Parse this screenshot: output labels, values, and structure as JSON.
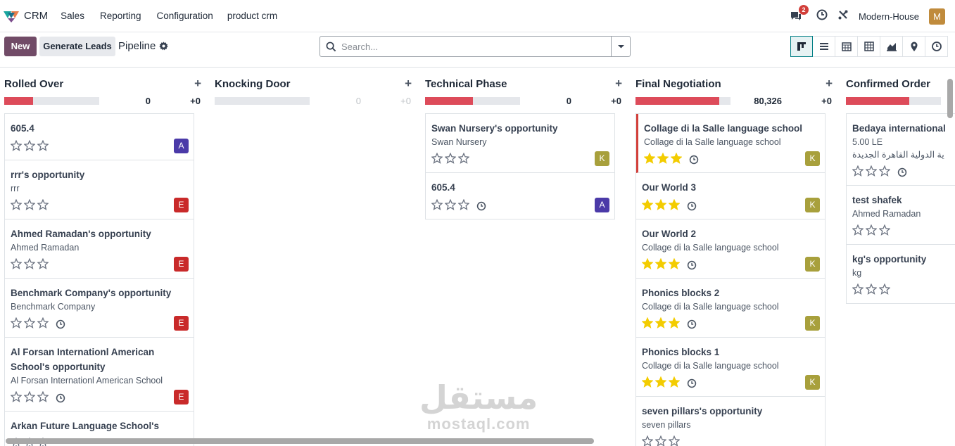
{
  "navbar": {
    "app_name": "CRM",
    "menu": [
      "Sales",
      "Reporting",
      "Configuration",
      "product crm"
    ],
    "message_count": "2",
    "company": "Modern-House",
    "user_initial": "M"
  },
  "control": {
    "new_label": "New",
    "generate_label": "Generate Leads",
    "breadcrumb": "Pipeline",
    "search_placeholder": "Search..."
  },
  "columns": [
    {
      "title": "Rolled Over",
      "total": "0",
      "plus": "+0",
      "progress": 0.3,
      "cards": [
        {
          "title": "605.4",
          "sub": "",
          "stars": 0,
          "clock": false,
          "user": "A",
          "user_color": "#4b3aa8"
        },
        {
          "title": "rrr's opportunity",
          "sub": "rrr",
          "stars": 0,
          "clock": false,
          "user": "E",
          "user_color": "#c92a2a"
        },
        {
          "title": "Ahmed Ramadan's opportunity",
          "sub": "Ahmed Ramadan",
          "stars": 0,
          "clock": false,
          "user": "E",
          "user_color": "#c92a2a"
        },
        {
          "title": "Benchmark Company's opportunity",
          "sub": "Benchmark Company",
          "stars": 0,
          "clock": true,
          "user": "E",
          "user_color": "#c92a2a"
        },
        {
          "title": "Al Forsan Internationl American School's opportunity",
          "sub": "Al Forsan Internationl American School",
          "stars": 0,
          "clock": true,
          "user": "E",
          "user_color": "#c92a2a"
        },
        {
          "title": "Arkan Future Language School's",
          "sub": "",
          "stars": 0,
          "clock": false,
          "user": "",
          "user_color": "#c92a2a"
        }
      ]
    },
    {
      "title": "Knocking Door",
      "total": "0",
      "plus": "+0",
      "progress": 0,
      "cards": []
    },
    {
      "title": "Technical Phase",
      "total": "0",
      "plus": "+0",
      "progress": 0.5,
      "cards": [
        {
          "title": "Swan Nursery's opportunity",
          "sub": "Swan Nursery",
          "stars": 0,
          "clock": false,
          "user": "K",
          "user_color": "#a8a03c"
        },
        {
          "title": "605.4",
          "sub": "",
          "stars": 0,
          "clock": true,
          "user": "A",
          "user_color": "#4b3aa8"
        }
      ]
    },
    {
      "title": "Final Negotiation",
      "total": "80,326",
      "plus": "+0",
      "progress": 0.88,
      "cards": [
        {
          "title": "Collage di la Salle language school",
          "sub": "Collage di la Salle language school",
          "stars": 3,
          "clock": true,
          "user": "K",
          "user_color": "#a8a03c",
          "accent": true
        },
        {
          "title": "Our World 3",
          "sub": "",
          "stars": 3,
          "clock": true,
          "user": "K",
          "user_color": "#a8a03c"
        },
        {
          "title": "Our World 2",
          "sub": "Collage di la Salle language school",
          "stars": 3,
          "clock": true,
          "user": "K",
          "user_color": "#a8a03c"
        },
        {
          "title": "Phonics blocks 2",
          "sub": "Collage di la Salle language school",
          "stars": 3,
          "clock": true,
          "user": "K",
          "user_color": "#a8a03c"
        },
        {
          "title": "Phonics blocks 1",
          "sub": "Collage di la Salle language school",
          "stars": 3,
          "clock": true,
          "user": "K",
          "user_color": "#a8a03c"
        },
        {
          "title": "seven pillars's opportunity",
          "sub": "seven pillars",
          "stars": 0,
          "clock": false,
          "user": "",
          "user_color": "#4b3aa8"
        }
      ]
    },
    {
      "title": "Confirmed Order",
      "total": "",
      "plus": "",
      "progress": 0.67,
      "cards": [
        {
          "title": "Bedaya international",
          "sub": "5.00 LE",
          "sub2": "ية الدولية القاهرة الجديدة",
          "stars": 0,
          "clock": true,
          "user": "",
          "user_color": "#a8a03c"
        },
        {
          "title": "test shafek",
          "sub": "Ahmed Ramadan",
          "stars": 0,
          "clock": false,
          "user": "",
          "user_color": "#a8a03c"
        },
        {
          "title": "kg's opportunity",
          "sub": "kg",
          "stars": 0,
          "clock": false,
          "user": "",
          "user_color": "#a8a03c"
        }
      ]
    }
  ],
  "watermark": {
    "arabic": "مستقل",
    "latin": "mostaql.com"
  },
  "colors": {
    "brand": "#714b67",
    "progress_red": "#dd4b5a",
    "star_gold": "#f3cc00"
  },
  "icons": [
    "crm-logo-icon",
    "chat-icon",
    "clock-icon",
    "tools-icon",
    "gear-icon",
    "search-icon",
    "chevron-down-icon",
    "kanban-view-icon",
    "list-view-icon",
    "calendar-view-icon",
    "pivot-view-icon",
    "graph-view-icon",
    "map-view-icon",
    "activity-view-icon",
    "star-icon"
  ]
}
